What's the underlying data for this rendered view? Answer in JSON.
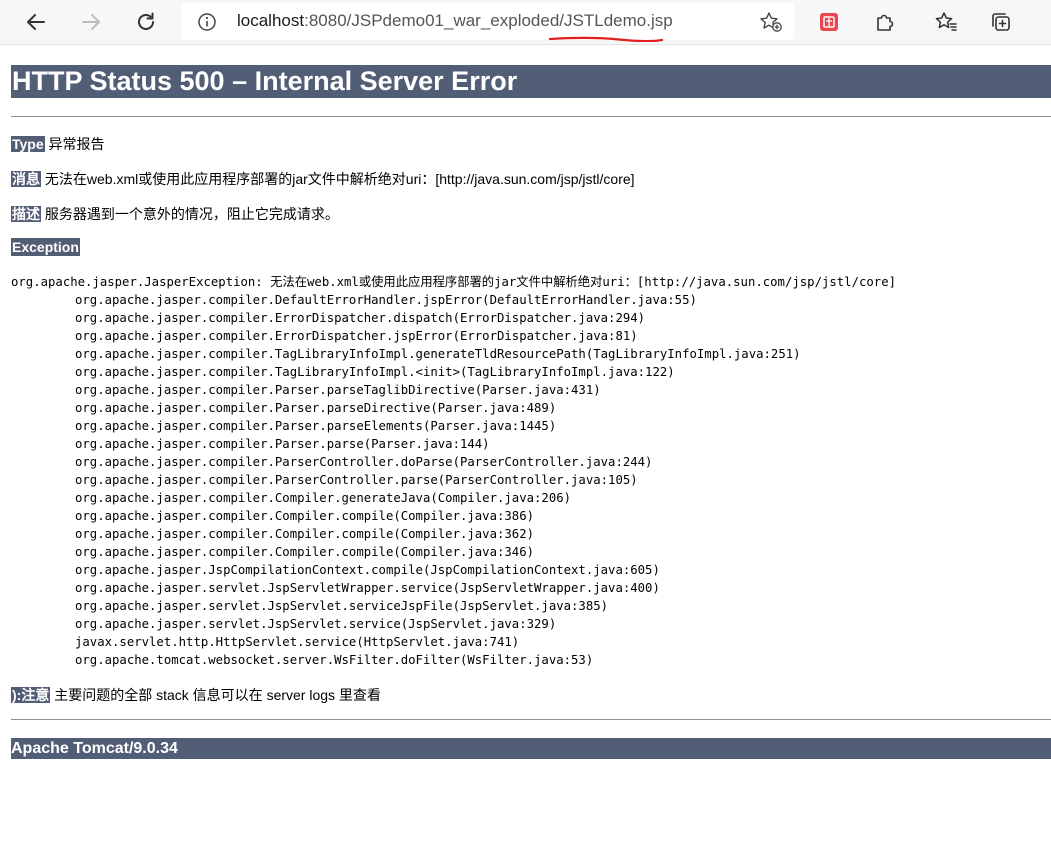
{
  "browser": {
    "url_host": "localhost",
    "url_path": ":8080/JSPdemo01_war_exploded/JSTLdemo.jsp",
    "icons": [
      "back-icon",
      "forward-icon",
      "refresh-icon",
      "info-icon",
      "favorite-add-icon",
      "extension-red-icon",
      "extensions-icon",
      "favorites-icon",
      "collections-icon"
    ]
  },
  "page": {
    "title": "HTTP Status 500 – Internal Server Error",
    "type_label": "Type",
    "type_value": "异常报告",
    "message_label": "消息",
    "message_value": "无法在web.xml或使用此应用程序部署的jar文件中解析绝对uri：[http://java.sun.com/jsp/jstl/core]",
    "description_label": "描述",
    "description_value": "服务器遇到一个意外的情况，阻止它完成请求。",
    "exception_heading": "Exception",
    "exception_first_line": "org.apache.jasper.JasperException: 无法在web.xml或使用此应用程序部署的jar文件中解析绝对uri：[http://java.sun.com/jsp/jstl/core]",
    "stack_trace": [
      "org.apache.jasper.compiler.DefaultErrorHandler.jspError(DefaultErrorHandler.java:55)",
      "org.apache.jasper.compiler.ErrorDispatcher.dispatch(ErrorDispatcher.java:294)",
      "org.apache.jasper.compiler.ErrorDispatcher.jspError(ErrorDispatcher.java:81)",
      "org.apache.jasper.compiler.TagLibraryInfoImpl.generateTldResourcePath(TagLibraryInfoImpl.java:251)",
      "org.apache.jasper.compiler.TagLibraryInfoImpl.<init>(TagLibraryInfoImpl.java:122)",
      "org.apache.jasper.compiler.Parser.parseTaglibDirective(Parser.java:431)",
      "org.apache.jasper.compiler.Parser.parseDirective(Parser.java:489)",
      "org.apache.jasper.compiler.Parser.parseElements(Parser.java:1445)",
      "org.apache.jasper.compiler.Parser.parse(Parser.java:144)",
      "org.apache.jasper.compiler.ParserController.doParse(ParserController.java:244)",
      "org.apache.jasper.compiler.ParserController.parse(ParserController.java:105)",
      "org.apache.jasper.compiler.Compiler.generateJava(Compiler.java:206)",
      "org.apache.jasper.compiler.Compiler.compile(Compiler.java:386)",
      "org.apache.jasper.compiler.Compiler.compile(Compiler.java:362)",
      "org.apache.jasper.compiler.Compiler.compile(Compiler.java:346)",
      "org.apache.jasper.JspCompilationContext.compile(JspCompilationContext.java:605)",
      "org.apache.jasper.servlet.JspServletWrapper.service(JspServletWrapper.java:400)",
      "org.apache.jasper.servlet.JspServlet.serviceJspFile(JspServlet.java:385)",
      "org.apache.jasper.servlet.JspServlet.service(JspServlet.java:329)",
      "javax.servlet.http.HttpServlet.service(HttpServlet.java:741)",
      "org.apache.tomcat.websocket.server.WsFilter.doFilter(WsFilter.java:53)"
    ],
    "note_label": "):注意",
    "note_value": "主要问题的全部 stack 信息可以在 server logs 里查看",
    "footer": "Apache Tomcat/9.0.34"
  },
  "colors": {
    "heading_bg": "#525d76",
    "heading_fg": "#ffffff",
    "url_underline": "#e02020"
  }
}
